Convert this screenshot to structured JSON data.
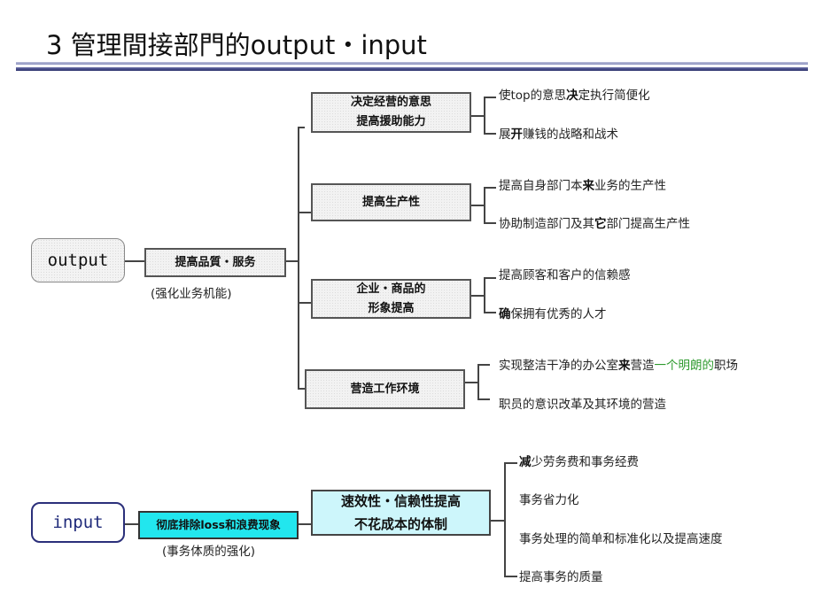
{
  "title": "3 管理間接部門的output・input",
  "output_section": {
    "root_label": "output",
    "main_box": "提高品質・服务",
    "main_caption": "(强化业务机能)",
    "branches": [
      {
        "label_line1": "决定经营的意思",
        "label_line2": "提高援助能力",
        "leaves": [
          {
            "pre": "使top的意思",
            "bold": "决",
            "post": "定执行简便化"
          },
          {
            "pre": "展",
            "bold": "开",
            "post": "赚钱的战略和战术"
          }
        ]
      },
      {
        "label_line1": "提高生产性",
        "label_line2": "",
        "leaves": [
          {
            "pre": "提高自身部门本",
            "bold": "来",
            "post": "业务的生产性"
          },
          {
            "pre": "协助制造部门及其",
            "bold": "它",
            "post": "部门提高生产性"
          }
        ]
      },
      {
        "label_line1": "企业・商品的",
        "label_line2": "形象提高",
        "leaves": [
          {
            "pre": "提高顾客和客户的信赖感",
            "bold": "",
            "post": ""
          },
          {
            "pre": "",
            "bold": "确",
            "post": "保拥有优秀的人才"
          }
        ]
      },
      {
        "label_line1": "营造工作环境",
        "label_line2": "",
        "leaves": [
          {
            "pre": "实现整洁干净的办公室",
            "bold": "来",
            "post": "营造",
            "green": "一个明朗的",
            "tail": "职场"
          },
          {
            "pre": "职员的意识改革及其环境的营造",
            "bold": "",
            "post": ""
          }
        ]
      }
    ]
  },
  "input_section": {
    "root_label": "input",
    "main_box": "彻底排除loss和浪费现象",
    "main_caption": "(事务体质的强化)",
    "second_box_line1": "速效性・信赖性提高",
    "second_box_line2": "不花成本的体制",
    "leaves": [
      {
        "pre": "",
        "bold": "减",
        "post": "少劳务费和事务经费"
      },
      {
        "pre": "事务省力化",
        "bold": "",
        "post": ""
      },
      {
        "pre": "事务处理的简单和标准化以及提高速度",
        "bold": "",
        "post": ""
      },
      {
        "pre": "提高事务的质量",
        "bold": "",
        "post": ""
      }
    ]
  },
  "colors": {
    "accent_cyan": "#22e6ee",
    "light_cyan": "#cdf6fb",
    "navy": "#2b2f7a",
    "green_text": "#2e9a2e"
  }
}
